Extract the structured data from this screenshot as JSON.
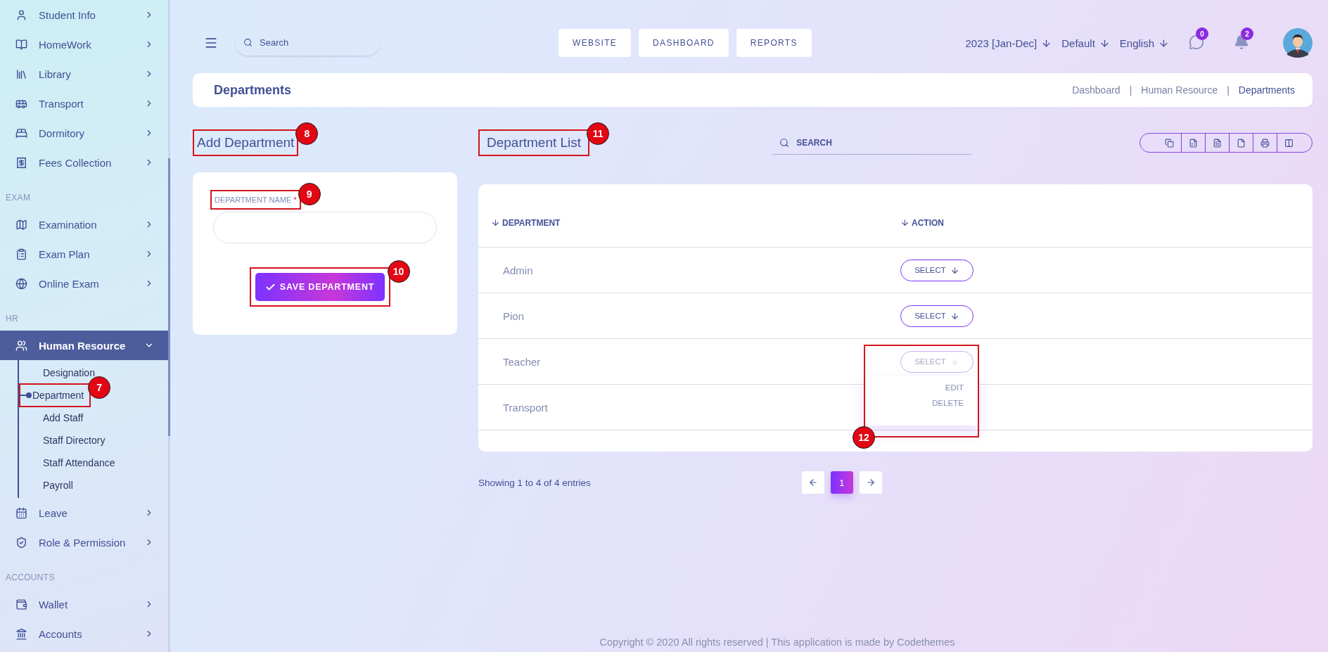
{
  "sidebar": {
    "sections": [
      {
        "items": [
          {
            "label": "Student Info",
            "expanded": false
          },
          {
            "label": "HomeWork",
            "expanded": false
          },
          {
            "label": "Library",
            "expanded": false
          },
          {
            "label": "Transport",
            "expanded": false
          },
          {
            "label": "Dormitory",
            "expanded": false
          },
          {
            "label": "Fees Collection",
            "expanded": false
          }
        ]
      },
      {
        "title": "EXAM",
        "items": [
          {
            "label": "Examination",
            "expanded": false
          },
          {
            "label": "Exam Plan",
            "expanded": false
          },
          {
            "label": "Online Exam",
            "expanded": false
          }
        ]
      },
      {
        "title": "HR",
        "items": [
          {
            "label": "Human Resource",
            "expanded": true,
            "children": [
              {
                "label": "Designation",
                "selected": false
              },
              {
                "label": "Department",
                "selected": true,
                "callout": "7"
              },
              {
                "label": "Add Staff",
                "selected": false
              },
              {
                "label": "Staff Directory",
                "selected": false
              },
              {
                "label": "Staff Attendance",
                "selected": false
              },
              {
                "label": "Payroll",
                "selected": false
              }
            ]
          },
          {
            "label": "Leave",
            "expanded": false
          },
          {
            "label": "Role & Permission",
            "expanded": false
          }
        ]
      },
      {
        "title": "ACCOUNTS",
        "items": [
          {
            "label": "Wallet",
            "expanded": false
          },
          {
            "label": "Accounts",
            "expanded": false
          }
        ]
      }
    ]
  },
  "topbar": {
    "search": {
      "placeholder": "Search"
    },
    "nav_buttons": [
      "WEBSITE",
      "DASHBOARD",
      "REPORTS"
    ],
    "selectors": [
      "2023 [Jan-Dec]",
      "Default",
      "English"
    ],
    "messages_badge": "0",
    "notifications_badge": "2"
  },
  "page_header": {
    "title": "Departments",
    "breadcrumbs": [
      "Dashboard",
      "Human Resource",
      "Departments"
    ],
    "separators": [
      "|",
      "|"
    ]
  },
  "add_form": {
    "title": "Add Department",
    "title_callout": "8",
    "field": {
      "label": "DEPARTMENT NAME",
      "required_mark": "*",
      "callout": "9"
    },
    "save_button": {
      "label": "SAVE DEPARTMENT",
      "callout": "10"
    }
  },
  "list": {
    "title": "Department List",
    "title_callout": "11",
    "search": {
      "placeholder": "SEARCH"
    },
    "columns": [
      "DEPARTMENT",
      "ACTION"
    ],
    "rows": [
      {
        "name": "Admin",
        "action": "SELECT",
        "open": false
      },
      {
        "name": "Pion",
        "action": "SELECT",
        "open": false
      },
      {
        "name": "Teacher",
        "action": "SELECT",
        "open": true,
        "callout": "12",
        "menu": [
          "EDIT",
          "DELETE"
        ]
      },
      {
        "name": "Transport",
        "open": false
      }
    ],
    "info": "Showing 1 to 4 of 4 entries",
    "pages": [
      {
        "label": "1",
        "selected": true
      }
    ]
  },
  "footer": "Copyright © 2020 All rights reserved | This application is made by Codethemes"
}
